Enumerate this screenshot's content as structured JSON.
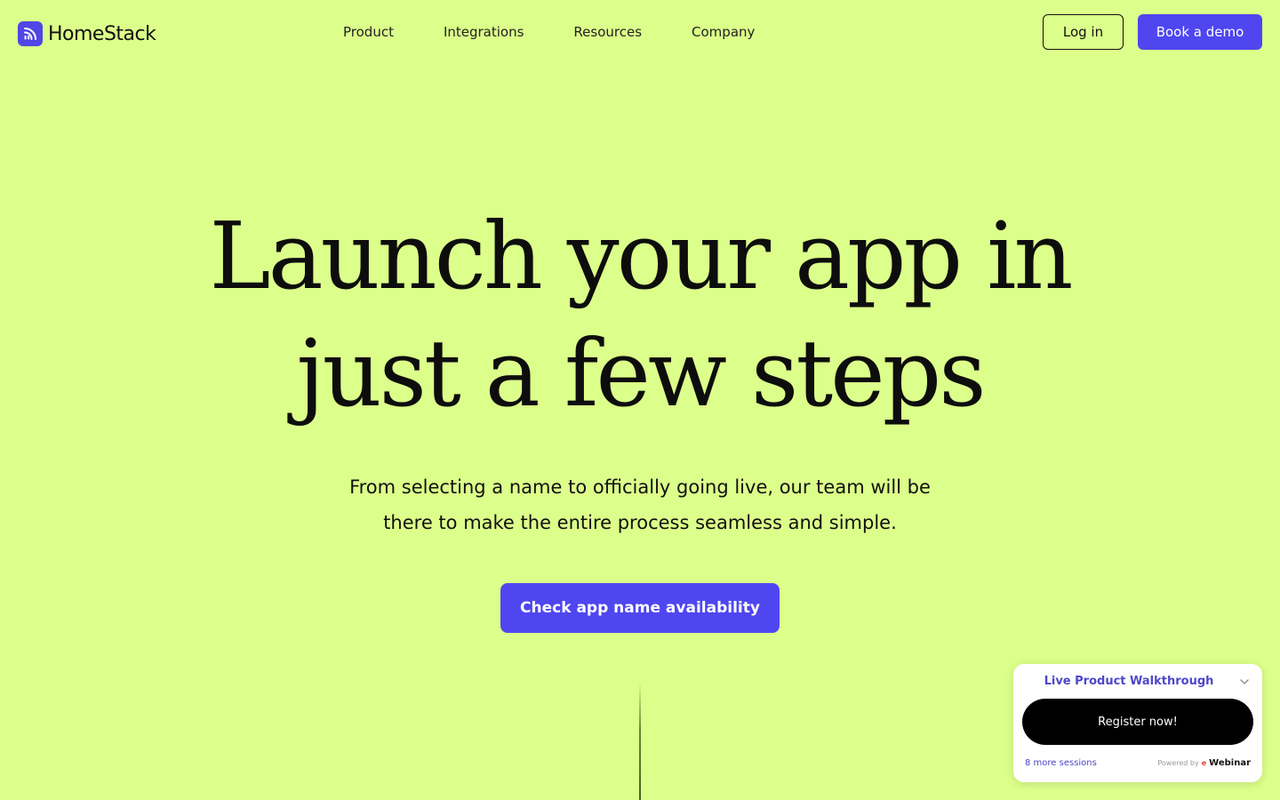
{
  "brand": {
    "name": "HomeStack",
    "accent_color": "#4f46f0",
    "background_color": "#dcfe8a"
  },
  "nav": {
    "links": [
      {
        "label": "Product"
      },
      {
        "label": "Integrations"
      },
      {
        "label": "Resources"
      },
      {
        "label": "Company"
      }
    ],
    "login_label": "Log in",
    "demo_label": "Book a demo"
  },
  "hero": {
    "title_line1": "Launch your app in",
    "title_line2": "just a few steps",
    "subtitle_line1": "From selecting a name to officially going live, our team will be",
    "subtitle_line2": "there to make the entire process seamless and simple.",
    "cta_label": "Check app name availability"
  },
  "webinar_widget": {
    "title": "Live Product Walkthrough",
    "register_label": "Register now!",
    "sessions_label": "8 more sessions",
    "powered_by": "Powered by",
    "provider_mark": "e",
    "provider_name": "Webinar",
    "chevron_icon": "chevron-down-icon"
  }
}
